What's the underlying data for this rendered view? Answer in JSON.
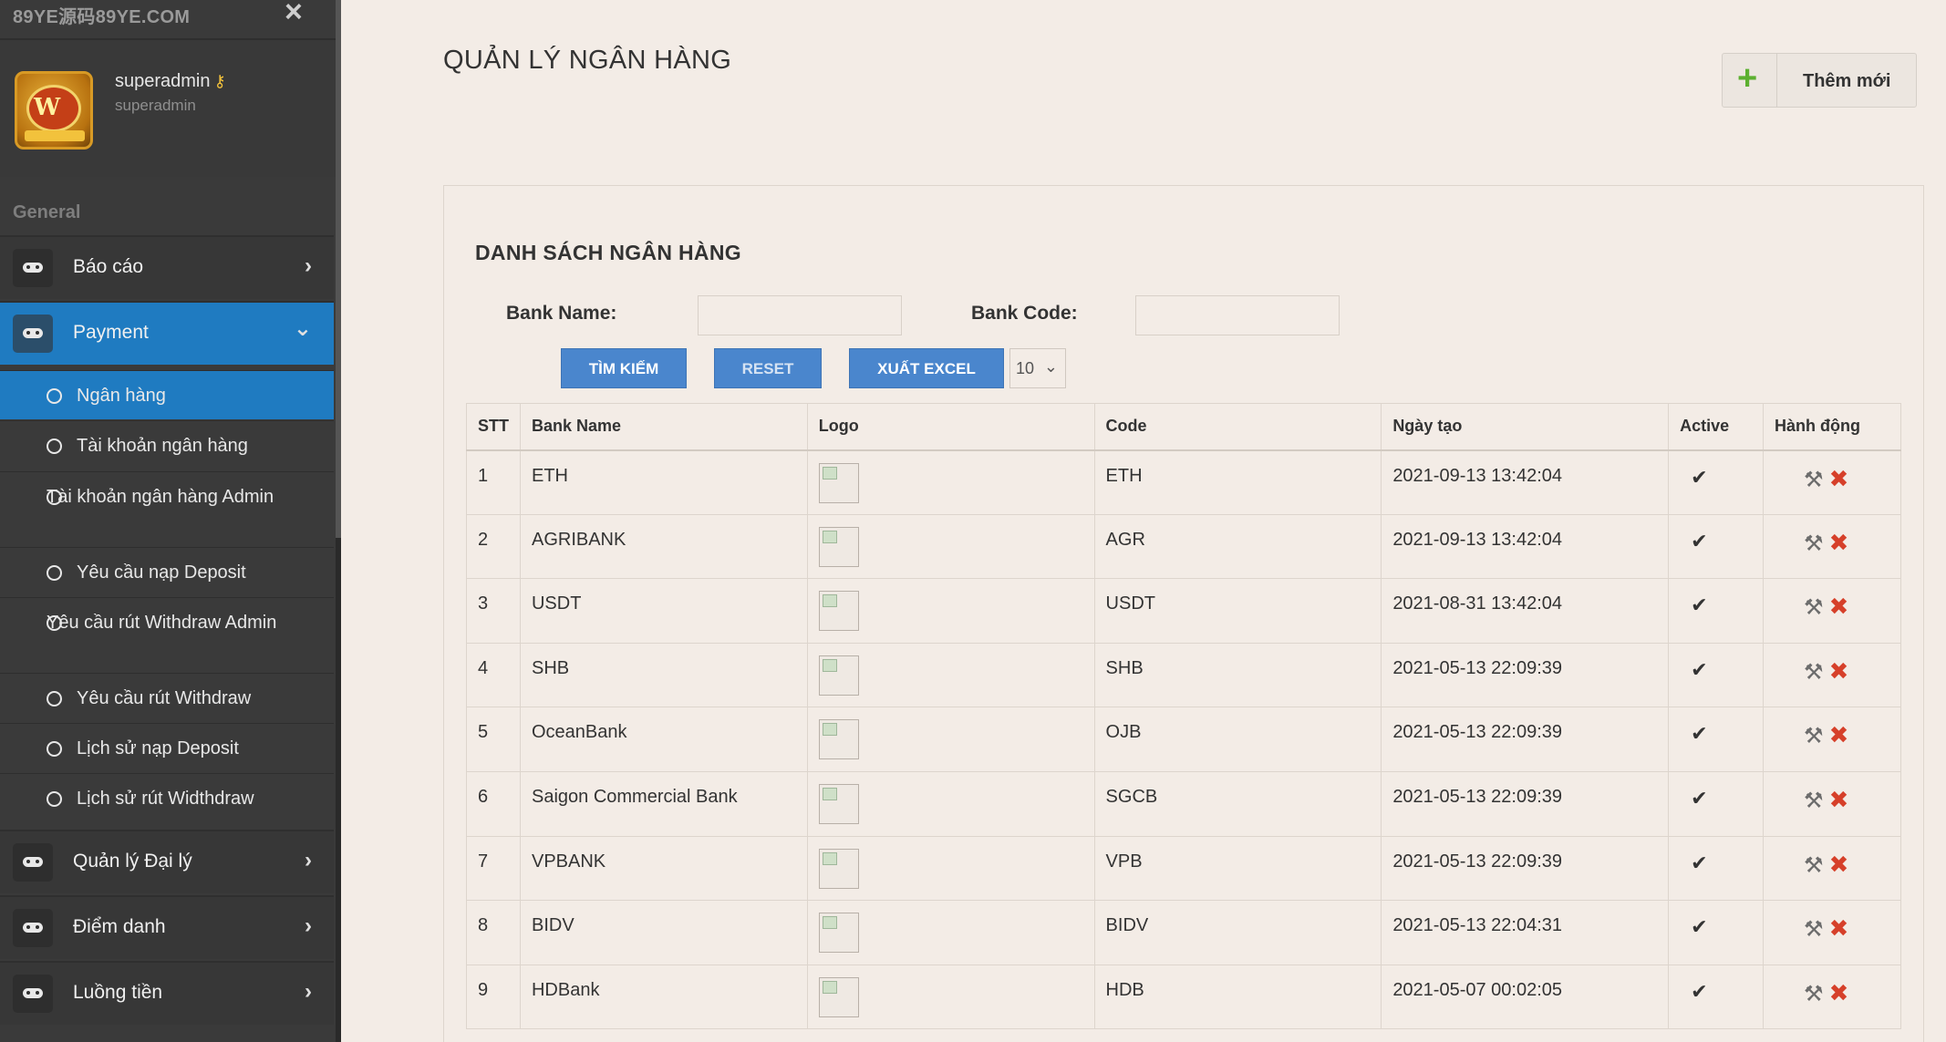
{
  "sidebar": {
    "brand": "89YE源码89YE.COM",
    "close_icon": "×",
    "profile": {
      "name": "superadmin",
      "role": "superadmin",
      "key_icon": "key-icon"
    },
    "section_label": "General",
    "menu": [
      {
        "label": "Báo cáo",
        "icon": "gamepad-icon",
        "chevron": "›"
      },
      {
        "label": "Payment",
        "icon": "gamepad-icon",
        "chevron": "⌄"
      },
      {
        "label": "Quản lý Đại lý",
        "icon": "gamepad-icon",
        "chevron": "›"
      },
      {
        "label": "Điểm danh",
        "icon": "gamepad-icon",
        "chevron": "›"
      },
      {
        "label": "Luồng tiền",
        "icon": "gamepad-icon",
        "chevron": "›"
      }
    ],
    "submenu": [
      "Ngân hàng",
      "Tài khoản ngân hàng",
      "Tài khoản ngân hàng Admin",
      "Yêu cầu nạp Deposit",
      "Yêu cầu rút Withdraw Admin",
      "Yêu cầu rút Withdraw",
      "Lịch sử nạp Deposit",
      "Lịch sử rút Widthdraw"
    ]
  },
  "header": {
    "title": "QUẢN LÝ NGÂN HÀNG",
    "add_label": "Thêm mới",
    "add_icon": "+"
  },
  "panel": {
    "title": "DANH SÁCH NGÂN HÀNG",
    "filters": {
      "bank_name_label": "Bank Name:",
      "bank_code_label": "Bank Code:",
      "bank_name_value": "",
      "bank_code_value": ""
    },
    "buttons": {
      "search": "TÌM KIẾM",
      "reset": "RESET",
      "export": "XUẤT EXCEL"
    },
    "page_size": "10",
    "columns": [
      "STT",
      "Bank Name",
      "Logo",
      "Code",
      "Ngày tạo",
      "Active",
      "Hành động"
    ],
    "rows": [
      {
        "stt": "1",
        "name": "ETH",
        "code": "ETH",
        "created": "2021-09-13 13:42:04"
      },
      {
        "stt": "2",
        "name": "AGRIBANK",
        "code": "AGR",
        "created": "2021-09-13 13:42:04"
      },
      {
        "stt": "3",
        "name": "USDT",
        "code": "USDT",
        "created": "2021-08-31 13:42:04"
      },
      {
        "stt": "4",
        "name": "SHB",
        "code": "SHB",
        "created": "2021-05-13 22:09:39"
      },
      {
        "stt": "5",
        "name": "OceanBank",
        "code": "OJB",
        "created": "2021-05-13 22:09:39"
      },
      {
        "stt": "6",
        "name": "Saigon Commercial Bank",
        "code": "SGCB",
        "created": "2021-05-13 22:09:39"
      },
      {
        "stt": "7",
        "name": "VPBANK",
        "code": "VPB",
        "created": "2021-05-13 22:09:39"
      },
      {
        "stt": "8",
        "name": "BIDV",
        "code": "BIDV",
        "created": "2021-05-13 22:04:31"
      },
      {
        "stt": "9",
        "name": "HDBank",
        "code": "HDB",
        "created": "2021-05-07 00:02:05"
      }
    ],
    "check_icon": "✔",
    "edit_icon": "⚒",
    "delete_icon": "✖"
  }
}
